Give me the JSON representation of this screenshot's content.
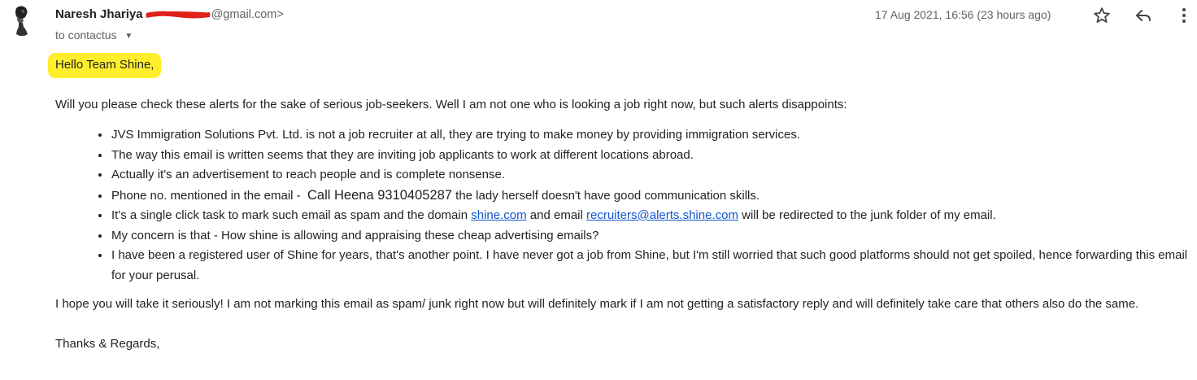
{
  "email": {
    "sender": {
      "name": "Naresh Jhariya",
      "email_suffix": "@gmail.com>"
    },
    "recipient": {
      "prefix": "to",
      "name": "contactus"
    },
    "timestamp": "17 Aug 2021, 16:56 (23 hours ago)",
    "icons": {
      "star": "star-outline-icon",
      "reply": "reply-icon",
      "more": "more-vert-icon"
    },
    "body": {
      "greeting": "Hello Team Shine,",
      "intro": "Will you please check these alerts for the sake of serious job-seekers. Well I am not one who is looking a job right now, but such alerts disappoints:",
      "bullets": [
        "JVS Immigration Solutions Pvt. Ltd. is not a job recruiter at all, they are trying to make money by providing immigration services.",
        "The way this email is written seems that they are inviting job applicants to work at different locations abroad.",
        "Actually it's an advertisement to reach people and is complete nonsense."
      ],
      "phone_bullet": {
        "prefix": "Phone no. mentioned in the email -",
        "highlight": "Call Heena 9310405287",
        "suffix": "the lady herself doesn't have good communication skills."
      },
      "spam_bullet": {
        "text_before": "It's a single click task to mark such email as spam and the domain",
        "domain_link": "shine.com",
        "text_middle": "and email",
        "email_link": "recruiters@alerts.shine.com",
        "text_after": "will be redirected to the junk folder of my email."
      },
      "bullets_after": [
        "My concern is that - How shine is allowing and appraising these cheap advertising emails?",
        "I have been a registered user of Shine for years, that's another point. I have never got a job from Shine, but I'm still worried that such good platforms should not get spoiled, hence forwarding this email for your perusal."
      ],
      "closing": "I hope you will take it seriously! I am not marking this email as spam/ junk right now but will definitely mark if I am not getting a satisfactory reply and will definitely take care that others also do the same.",
      "signoff": "Thanks & Regards,"
    },
    "colors": {
      "greeting_highlight": "#ffee2c",
      "link": "#1155cc",
      "redaction": "#e0201b",
      "meta_text": "#5f6368"
    }
  }
}
